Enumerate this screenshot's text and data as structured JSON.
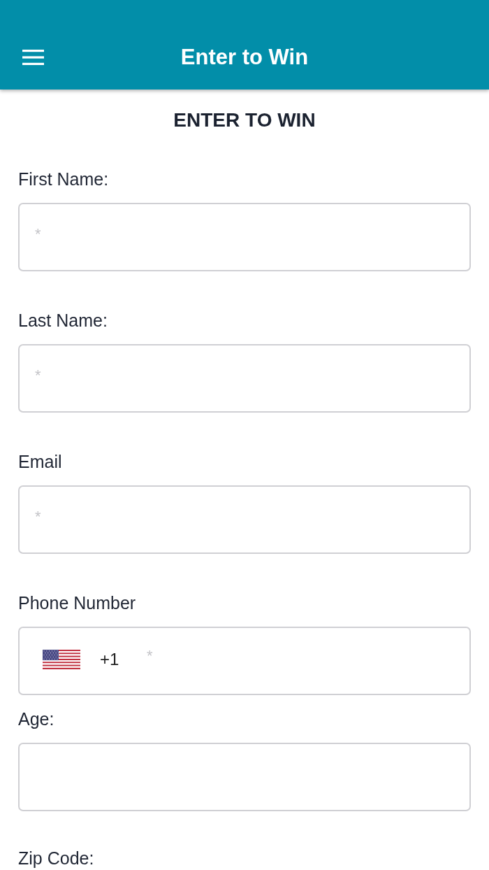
{
  "app_bar": {
    "title": "Enter to Win"
  },
  "form": {
    "heading": "ENTER TO WIN",
    "fields": [
      {
        "kind": "text",
        "label": "First Name:",
        "placeholder": "*"
      },
      {
        "kind": "text",
        "label": "Last Name:",
        "placeholder": "*"
      },
      {
        "kind": "text",
        "label": "Email",
        "placeholder": "*"
      },
      {
        "kind": "phone",
        "label": "Phone Number",
        "country_code": "+1",
        "placeholder": "*"
      },
      {
        "kind": "text",
        "label": "Age:"
      },
      {
        "kind": "label_only",
        "label": "Zip Code:"
      }
    ]
  }
}
